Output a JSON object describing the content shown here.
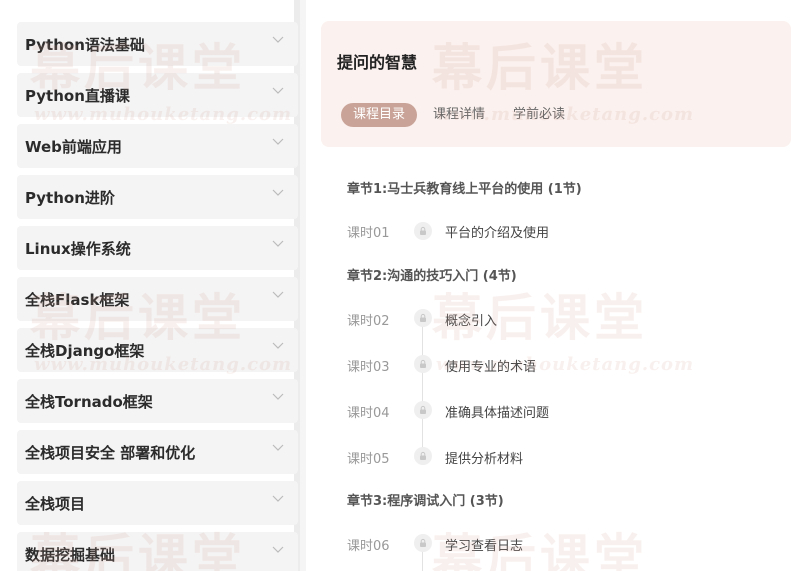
{
  "sidebar": {
    "items": [
      {
        "label": "Python语法基础"
      },
      {
        "label": "Python直播课"
      },
      {
        "label": "Web前端应用"
      },
      {
        "label": "Python进阶"
      },
      {
        "label": "Linux操作系统"
      },
      {
        "label": "全栈Flask框架"
      },
      {
        "label": "全栈Django框架"
      },
      {
        "label": "全栈Tornado框架"
      },
      {
        "label": "全栈项目安全 部署和优化"
      },
      {
        "label": "全栈项目"
      },
      {
        "label": "数据挖掘基础"
      }
    ]
  },
  "header": {
    "title": "提问的智慧",
    "tabs": [
      {
        "label": "课程目录"
      },
      {
        "label": "课程详情"
      },
      {
        "label": "学前必读"
      }
    ]
  },
  "chapters": [
    {
      "title": "章节1:马士兵教育线上平台的使用 (1节)"
    },
    {
      "title": "章节2:沟通的技巧入门 (4节)"
    },
    {
      "title": "章节3:程序调试入门 (3节)"
    }
  ],
  "lessons": [
    {
      "num": "课时01",
      "title": "平台的介绍及使用"
    },
    {
      "num": "课时02",
      "title": "概念引入"
    },
    {
      "num": "课时03",
      "title": "使用专业的术语"
    },
    {
      "num": "课时04",
      "title": "准确具体描述问题"
    },
    {
      "num": "课时05",
      "title": "提供分析材料"
    },
    {
      "num": "课时06",
      "title": "学习查看日志"
    }
  ],
  "watermark": {
    "big": "幕后课堂",
    "small": "www.muhouketang.com"
  },
  "colors": {
    "accent": "#c9a398",
    "header_bg": "#fbf1ee"
  }
}
